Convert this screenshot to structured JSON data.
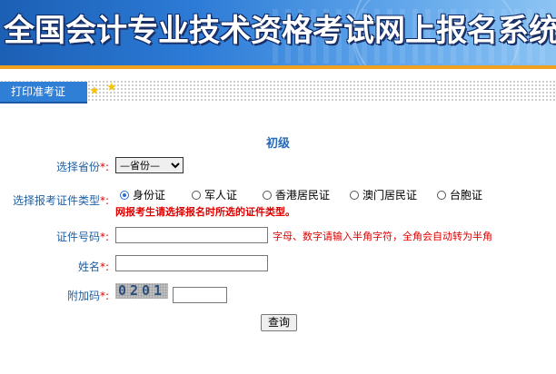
{
  "header": {
    "title": "全国会计专业技术资格考试网上报名系统"
  },
  "tabs": {
    "active_label": "打印准考证"
  },
  "form": {
    "heading": "初级",
    "province": {
      "label": "选择省份",
      "required_mark": "*:",
      "selected": "—省份—"
    },
    "id_type": {
      "label": "选择报考证件类型",
      "required_mark": "*:",
      "options": [
        "身份证",
        "军人证",
        "香港居民证",
        "澳门居民证",
        "台胞证"
      ],
      "selected_index": 0,
      "warning": "网报考生请选择报名时所选的证件类型。"
    },
    "id_number": {
      "label": "证件号码",
      "required_mark": "*:",
      "value": "",
      "hint": "字母、数字请输入半角字符，全角会自动转为半角"
    },
    "name": {
      "label": "姓名",
      "required_mark": "*:",
      "value": ""
    },
    "captcha": {
      "label": "附加码",
      "required_mark": "*:",
      "code": "0201",
      "value": ""
    },
    "submit_label": "查询"
  },
  "colors": {
    "banner": "#2c7bd6",
    "accent_bar": "#f0a020",
    "tab": "#2f7fd6",
    "label": "#1e5fa3",
    "warning": "#e00000"
  }
}
